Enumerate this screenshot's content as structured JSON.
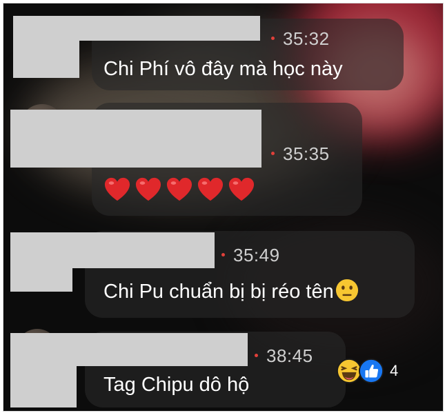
{
  "comments": [
    {
      "timestamp": "35:32",
      "message": "Chi Phí vô đây mà học này",
      "author_redacted": true
    },
    {
      "timestamp": "35:35",
      "message": "❤️❤️❤️❤️❤️",
      "hearts": 5,
      "author_redacted": true
    },
    {
      "timestamp": "35:49",
      "message": "Chi Pu chuẩn bị bị réo tên",
      "trailing_emoji": "neutral-face-icon",
      "author_redacted": true
    },
    {
      "timestamp": "38:45",
      "message": "Tag Chipu dô hộ",
      "author_redacted": true,
      "reactions": {
        "icons": [
          "laughing-reaction-icon",
          "like-reaction-icon"
        ],
        "count": "4"
      }
    }
  ],
  "colors": {
    "live_dot": "#e2403a",
    "like_blue": "#1877f2",
    "emoji_yellow": "#f7c631",
    "heart_red": "#e0282b",
    "redaction_gray": "#cfcfcf"
  }
}
